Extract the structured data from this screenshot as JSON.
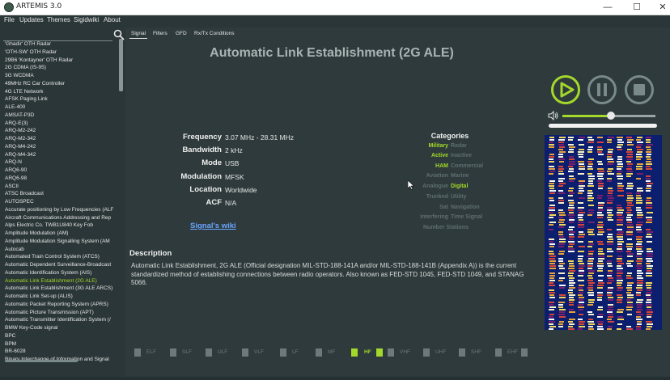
{
  "window": {
    "title": "ARTEMIS 3.0",
    "minimize_glyph": "—",
    "maximize_glyph": "☐",
    "close_glyph": "✕"
  },
  "menu": [
    "File",
    "Updates",
    "Themes",
    "Sigidwiki",
    "About"
  ],
  "search": {
    "placeholder": "",
    "value": ""
  },
  "signals": [
    "'Ghadir' OTH Radar",
    "'OTH-SW' OTH Radar",
    "29B6 'Kontayner' OTH Radar",
    "2G CDMA (IS-95)",
    "3G WCDMA",
    "49MHz RC Car Controller",
    "4G LTE Network",
    "AFSK Paging Link",
    "ALE-400",
    "AMSAT-P3D",
    "ARQ-E(3)",
    "ARQ-M2-242",
    "ARQ-M2-342",
    "ARQ-M4-242",
    "ARQ-M4-342",
    "ARQ-N",
    "ARQ6-90",
    "ARQ6-98",
    "ASCII",
    "ATSC Broadcast",
    "AUTOSPEC",
    "Accurate positioning by Low Frequencies (ALF",
    "Aircraft Communications Addressing and Rep",
    "Alps Electric Co. TWB1U840 Key Fob",
    "Amplitude Modulation (AM)",
    "Amplitude Modulation Signalling System (AM",
    "Autocab",
    "Automated Train Control System (ATCS)",
    "Automatic Dependent Surveillance-Broadcast",
    "Automatic Identification System (AIS)",
    "Automatic Link Establishment (2G ALE)",
    "Automatic Link Establishment (3G ALE ARCS)",
    "Automatic Link Set-up (ALIS)",
    "Automatic Packet Reporting System (APRS)",
    "Automatic Picture Transmission (APT)",
    "Automatic Transmitter Identification System (/",
    "BMW Key-Code signal",
    "BPC",
    "BPM",
    "BR-6028",
    "Binary Interchange of Information and Signal"
  ],
  "selected_signal_index": 30,
  "tabs": [
    {
      "label": "Signal",
      "active": true
    },
    {
      "label": "Filters",
      "active": false
    },
    {
      "label": "GFD",
      "active": false
    },
    {
      "label": "Rx/Tx Conditions",
      "active": false
    }
  ],
  "signal": {
    "title": "Automatic Link Establishment (2G ALE)",
    "fields": [
      {
        "label": "Frequency",
        "value": "3.07 MHz - 28.31 MHz"
      },
      {
        "label": "Bandwidth",
        "value": "2 kHz"
      },
      {
        "label": "Mode",
        "value": "USB"
      },
      {
        "label": "Modulation",
        "value": "MFSK"
      },
      {
        "label": "Location",
        "value": "Worldwide"
      },
      {
        "label": "ACF",
        "value": "N/A"
      }
    ],
    "wiki_link": "Signal's wiki"
  },
  "categories": {
    "title": "Categories",
    "rows": [
      {
        "left": "Military",
        "left_on": true,
        "right": "Radar",
        "right_on": false
      },
      {
        "left": "Active",
        "left_on": true,
        "right": "Inactive",
        "right_on": false
      },
      {
        "left": "HAM",
        "left_on": true,
        "right": "Commercial",
        "right_on": false
      },
      {
        "left": "Aviation",
        "left_on": false,
        "right": "Marine",
        "right_on": false
      },
      {
        "left": "Analogue",
        "left_on": false,
        "right": "Digital",
        "right_on": true
      },
      {
        "left": "Trunked",
        "left_on": false,
        "right": "Utility",
        "right_on": false
      },
      {
        "left": "Sat",
        "left_on": false,
        "right": "Navigation",
        "right_on": false
      },
      {
        "left": "Interfering",
        "left_on": false,
        "right": "Time Signal",
        "right_on": false
      },
      {
        "left": "Number Stations",
        "left_on": false,
        "right": "",
        "right_on": false
      }
    ]
  },
  "description": {
    "title": "Description",
    "text": "Automatic Link Establishment, 2G ALE (Official designation MIL-STD-188-141A and/or MIL-STD-188-141B (Appendix A)) is the current standardized method of establishing connections between radio operators. Also known as FED-STD 1045, FED-STD 1049, and STANAG 5066."
  },
  "bands": [
    {
      "label": "ELF",
      "on": false
    },
    {
      "label": "SLF",
      "on": false
    },
    {
      "label": "ULF",
      "on": false
    },
    {
      "label": "VLF",
      "on": false
    },
    {
      "label": "LF",
      "on": false
    },
    {
      "label": "MF",
      "on": false
    },
    {
      "label": "HF",
      "on": true
    },
    {
      "label": "VHF",
      "on": false
    },
    {
      "label": "UHF",
      "on": false
    },
    {
      "label": "SHF",
      "on": false
    },
    {
      "label": "EHF",
      "on": false
    }
  ],
  "player": {
    "play_icon": "play-icon",
    "pause_icon": "pause-icon",
    "stop_icon": "stop-icon",
    "volume_level": 0.52,
    "playback_progress": 0.0,
    "accent_color": "#a4d82a",
    "inactive_color": "#7a8a8a"
  },
  "colors": {
    "background": "#2e3a3c",
    "accent": "#a4d82a",
    "link": "#6aa6ff",
    "inactive_text": "#5f6e6e"
  }
}
